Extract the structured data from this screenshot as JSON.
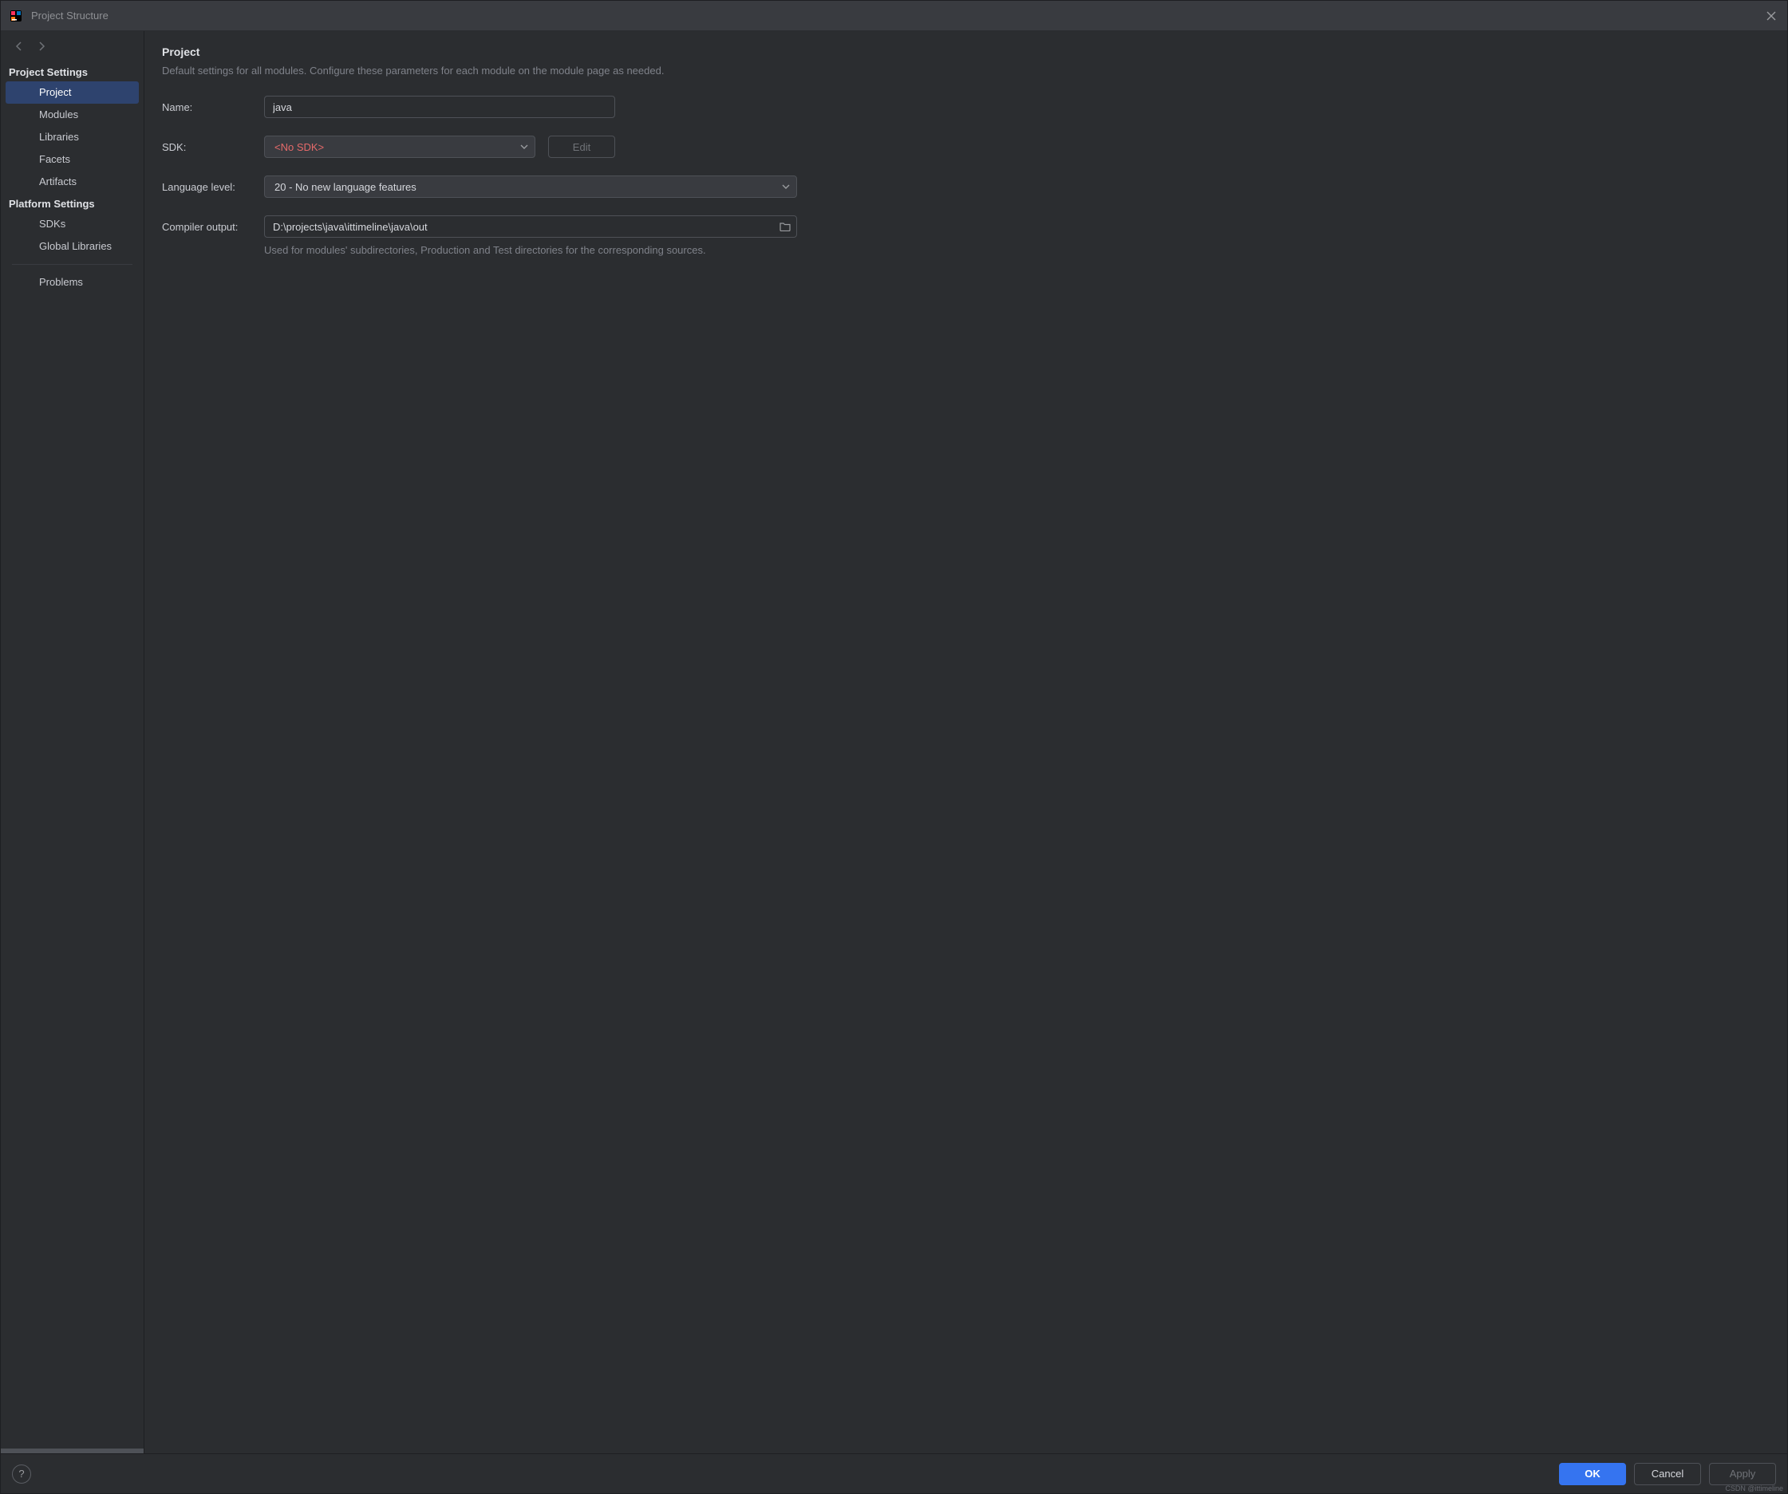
{
  "window": {
    "title": "Project Structure"
  },
  "sidebar": {
    "section1_header": "Project Settings",
    "section2_header": "Platform Settings",
    "items_project_settings": [
      {
        "label": "Project",
        "selected": true
      },
      {
        "label": "Modules"
      },
      {
        "label": "Libraries"
      },
      {
        "label": "Facets"
      },
      {
        "label": "Artifacts"
      }
    ],
    "items_platform_settings": [
      {
        "label": "SDKs"
      },
      {
        "label": "Global Libraries"
      }
    ],
    "items_other": [
      {
        "label": "Problems"
      }
    ]
  },
  "main": {
    "title": "Project",
    "subtitle": "Default settings for all modules. Configure these parameters for each module on the module page as needed.",
    "name_label": "Name:",
    "name_value": "java",
    "sdk_label": "SDK:",
    "sdk_value": "<No SDK>",
    "sdk_edit_label": "Edit",
    "lang_label": "Language level:",
    "lang_value": "20 - No new language features",
    "compiler_label": "Compiler output:",
    "compiler_value": "D:\\projects\\java\\ittimeline\\java\\out",
    "compiler_hint": "Used for modules' subdirectories, Production and Test directories for the corresponding sources."
  },
  "footer": {
    "help": "?",
    "ok": "OK",
    "cancel": "Cancel",
    "apply": "Apply"
  },
  "watermark": "CSDN @ittimeline"
}
